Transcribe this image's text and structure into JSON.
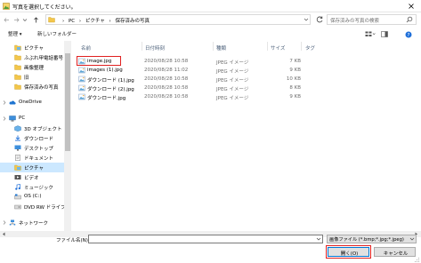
{
  "window": {
    "title": "写真を選択してください。",
    "close_glyph": "✕"
  },
  "address": {
    "breadcrumbs": [
      "PC",
      "ピクチャ",
      "保存済みの写真"
    ],
    "separator": "›",
    "search_placeholder": "保存済みの写真の検索"
  },
  "toolbar": {
    "organize": "整理 ▾",
    "new_folder": "新しいフォルダー"
  },
  "nav": {
    "items": [
      {
        "label": "ピクチャ",
        "icon": "pictures-folder-icon",
        "indent": 1,
        "selected": false
      },
      {
        "label": "ふぶれ甲電話番号",
        "icon": "folder-icon",
        "indent": 1,
        "selected": false
      },
      {
        "label": "画像整理",
        "icon": "folder-icon",
        "indent": 1,
        "selected": false
      },
      {
        "label": "旧",
        "icon": "folder-icon",
        "indent": 1,
        "selected": false
      },
      {
        "label": "保存済みの写真",
        "icon": "folder-icon",
        "indent": 1,
        "selected": false
      },
      {
        "label": "OneDrive",
        "icon": "onedrive-cloud-icon",
        "indent": 0,
        "selected": false
      },
      {
        "label": "PC",
        "icon": "pc-icon",
        "indent": 0,
        "selected": false
      },
      {
        "label": "3D オブジェクト",
        "icon": "3d-objects-icon",
        "indent": 1,
        "selected": false
      },
      {
        "label": "ダウンロード",
        "icon": "download-icon",
        "indent": 1,
        "selected": false
      },
      {
        "label": "デスクトップ",
        "icon": "desktop-icon",
        "indent": 1,
        "selected": false
      },
      {
        "label": "ドキュメント",
        "icon": "documents-icon",
        "indent": 1,
        "selected": false
      },
      {
        "label": "ピクチャ",
        "icon": "pictures-folder-icon",
        "indent": 1,
        "selected": true
      },
      {
        "label": "ビデオ",
        "icon": "videos-icon",
        "indent": 1,
        "selected": false
      },
      {
        "label": "ミュージック",
        "icon": "music-icon",
        "indent": 1,
        "selected": false
      },
      {
        "label": "OS (C:)",
        "icon": "drive-icon",
        "indent": 1,
        "selected": false
      },
      {
        "label": "DVD RW ドライブ (",
        "icon": "dvd-drive-icon",
        "indent": 1,
        "selected": false
      },
      {
        "label": "ネットワーク",
        "icon": "network-icon",
        "indent": 0,
        "selected": false
      }
    ]
  },
  "columns": {
    "name": "名前",
    "date": "日付時刻",
    "type": "種類",
    "size": "サイズ",
    "tag": "タグ"
  },
  "files": [
    {
      "name": "image.jpg",
      "date": "2020/08/28 10:58",
      "type": "JPEG イメージ",
      "size": "7 KB",
      "selected": true
    },
    {
      "name": "images (1).jpg",
      "date": "2020/08/28 11:02",
      "type": "JPEG イメージ",
      "size": "9 KB",
      "selected": false
    },
    {
      "name": "ダウンロード (1).jpg",
      "date": "2020/08/28 10:58",
      "type": "JPEG イメージ",
      "size": "10 KB",
      "selected": false
    },
    {
      "name": "ダウンロード (2).jpg",
      "date": "2020/08/28 10:58",
      "type": "JPEG イメージ",
      "size": "8 KB",
      "selected": false
    },
    {
      "name": "ダウンロード.jpg",
      "date": "2020/08/28 10:58",
      "type": "JPEG イメージ",
      "size": "9 KB",
      "selected": false
    }
  ],
  "bottom": {
    "filename_label": "ファイル名(N):",
    "filename_value": "",
    "filetype": "画像ファイル (*.bmp;*.jpg;*.jpeg)",
    "open_label": "開く(O)",
    "cancel_label": "キャンセル"
  },
  "colors": {
    "accent": "#0078d7",
    "highlight": "#e02020",
    "selected_bg": "#cce8ff",
    "folder": "#f3c64b"
  }
}
